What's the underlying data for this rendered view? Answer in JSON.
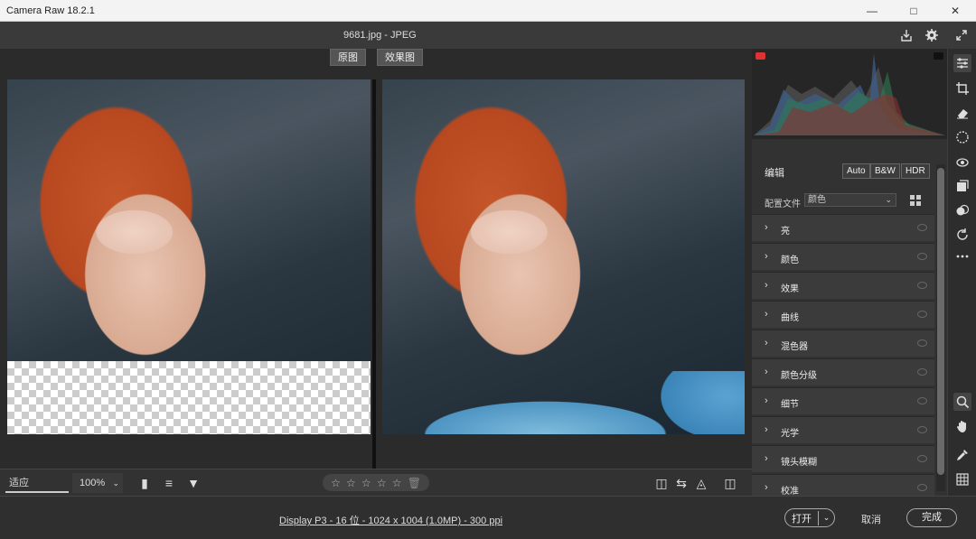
{
  "window": {
    "title": "Camera Raw 18.2.1"
  },
  "topbar": {
    "filename": "9681.jpg  -  JPEG"
  },
  "view": {
    "before_tab": "原图",
    "after_tab": "效果图"
  },
  "bottom_strip": {
    "zoom_fit": "适应 (122.7%)",
    "zoom_100": "100%",
    "stars": [
      "☆",
      "☆",
      "☆",
      "☆",
      "☆"
    ]
  },
  "statusbar": {
    "info": "Display P3 - 16 位 - 1024 x 1004 (1.0MP) - 300 ppi",
    "open_label": "打开",
    "cancel_label": "取消",
    "done_label": "完成"
  },
  "panel": {
    "edit_label": "编辑",
    "auto_label": "Auto",
    "bw_label": "B&W",
    "hdr_label": "HDR",
    "profile_label": "配置文件",
    "profile_value": "颜色",
    "sections": [
      {
        "label": "亮"
      },
      {
        "label": "颜色"
      },
      {
        "label": "效果"
      },
      {
        "label": "曲线"
      },
      {
        "label": "混色器"
      },
      {
        "label": "颜色分级"
      },
      {
        "label": "细节"
      },
      {
        "label": "光学"
      },
      {
        "label": "镜头模糊"
      },
      {
        "label": "校准"
      }
    ]
  },
  "colors": {
    "accent_red": "#d33333",
    "panel_bg": "#323232",
    "dark_bg": "#2b2b2b"
  },
  "icons": {
    "topbar": [
      "save-icon",
      "gear-icon",
      "expand-icon"
    ],
    "tools": [
      "sliders-icon",
      "crop-icon",
      "eraser-icon",
      "mask-icon",
      "redeye-icon",
      "presets-icon",
      "mix-icon",
      "rotate-icon",
      "more-icon",
      "zoom-icon",
      "hand-icon",
      "eyedropper-icon",
      "grid-icon"
    ]
  }
}
